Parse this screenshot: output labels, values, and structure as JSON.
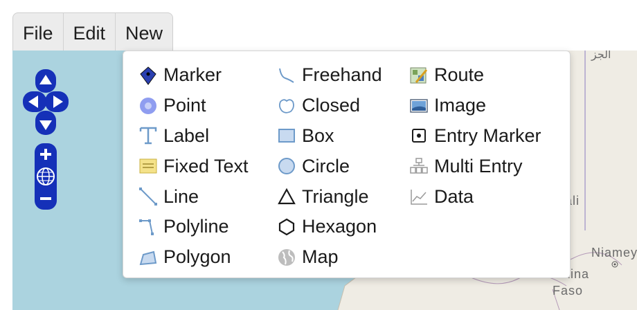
{
  "menubar": {
    "items": [
      {
        "label": "File"
      },
      {
        "label": "Edit"
      },
      {
        "label": "New"
      }
    ]
  },
  "map": {
    "labels": [
      "ali",
      "Niamey",
      "kina",
      "Faso"
    ],
    "top_text": "الجز"
  },
  "new_menu": {
    "columns": [
      [
        {
          "label": "Marker",
          "icon": "marker-icon"
        },
        {
          "label": "Point",
          "icon": "point-icon"
        },
        {
          "label": "Label",
          "icon": "label-icon"
        },
        {
          "label": "Fixed Text",
          "icon": "fixed-text-icon"
        },
        {
          "label": "Line",
          "icon": "line-icon"
        },
        {
          "label": "Polyline",
          "icon": "polyline-icon"
        },
        {
          "label": "Polygon",
          "icon": "polygon-icon"
        }
      ],
      [
        {
          "label": "Freehand",
          "icon": "freehand-icon"
        },
        {
          "label": "Closed",
          "icon": "closed-icon"
        },
        {
          "label": "Box",
          "icon": "box-icon"
        },
        {
          "label": "Circle",
          "icon": "circle-icon"
        },
        {
          "label": "Triangle",
          "icon": "triangle-icon"
        },
        {
          "label": "Hexagon",
          "icon": "hexagon-icon"
        },
        {
          "label": "Map",
          "icon": "map-icon"
        }
      ],
      [
        {
          "label": "Route",
          "icon": "route-icon"
        },
        {
          "label": "Image",
          "icon": "image-icon"
        },
        {
          "label": "Entry Marker",
          "icon": "entry-marker-icon"
        },
        {
          "label": "Multi Entry",
          "icon": "multi-entry-icon"
        },
        {
          "label": "Data",
          "icon": "data-icon"
        }
      ]
    ]
  },
  "colors": {
    "water": "#abd3df",
    "nav_blue": "#1530b8",
    "menubar_bg": "#ececec"
  }
}
